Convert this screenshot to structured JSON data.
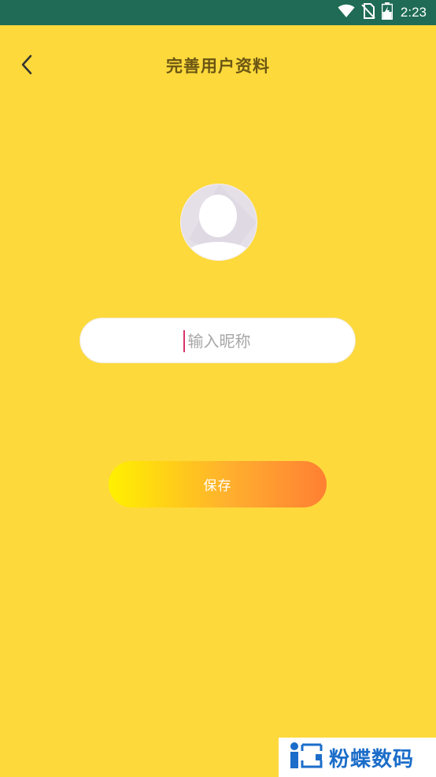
{
  "status_bar": {
    "time": "2:23",
    "icons": [
      "wifi-icon",
      "no-sim-icon",
      "battery-charging-icon"
    ]
  },
  "header": {
    "title": "完善用户资料",
    "back_icon": "chevron-left-icon"
  },
  "avatar": {
    "icon": "default-avatar-icon"
  },
  "nickname": {
    "placeholder": "输入昵称",
    "value": ""
  },
  "save_button": {
    "label": "保存"
  },
  "watermark": {
    "text": "粉蝶数码",
    "icon": "watermark-logo-icon"
  },
  "colors": {
    "background": "#FDD93B",
    "status_bar": "#1F6B55",
    "title": "#6B5614",
    "gradient_start": "#FFF000",
    "gradient_end": "#FF7F33",
    "cursor": "#D9326B",
    "watermark": "#1B6DC9"
  }
}
